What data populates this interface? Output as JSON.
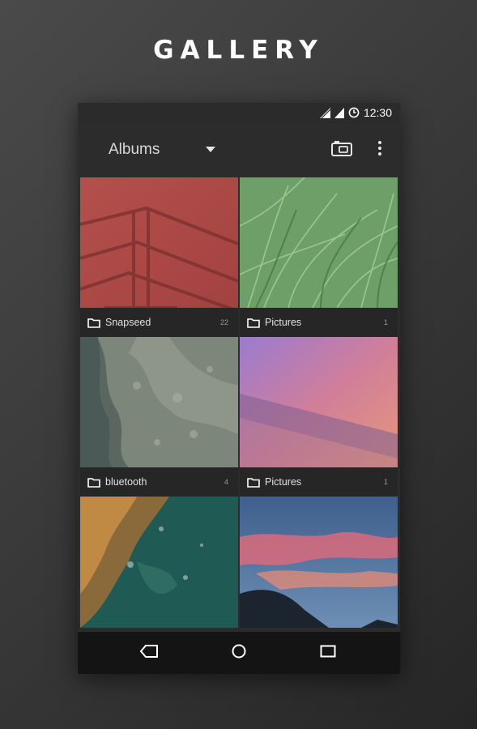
{
  "promo": {
    "title": "GALLERY"
  },
  "status_bar": {
    "time": "12:30"
  },
  "toolbar": {
    "album_selector_label": "Albums"
  },
  "albums": [
    {
      "name": "Snapseed",
      "count": "22",
      "thumbnail": "red-staircase"
    },
    {
      "name": "Pictures",
      "count": "1",
      "thumbnail": "green-grass"
    },
    {
      "name": "bluetooth",
      "count": "4",
      "thumbnail": "aerial-coastline"
    },
    {
      "name": "Pictures",
      "count": "1",
      "thumbnail": "purple-gradient"
    },
    {
      "name": "",
      "count": "",
      "thumbnail": "ocean-rocks"
    },
    {
      "name": "",
      "count": "",
      "thumbnail": "sunset-clouds"
    }
  ],
  "icons": {
    "signal": "signal-icon",
    "battery": "battery-icon",
    "dropdown": "dropdown-arrow-icon",
    "camera": "camera-icon",
    "overflow": "more-vert-icon",
    "folder": "folder-icon",
    "back": "back-icon",
    "home": "home-icon",
    "recents": "recents-icon"
  },
  "colors": {
    "background": "#3a3a3a",
    "surface": "#2c2c2c",
    "caption": "#262626",
    "navbar": "#141414"
  }
}
